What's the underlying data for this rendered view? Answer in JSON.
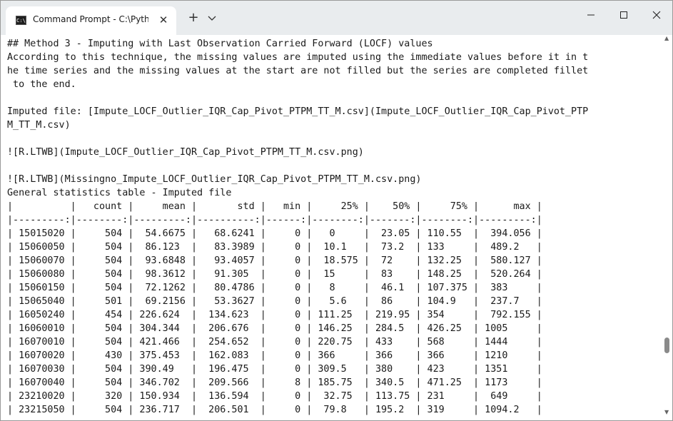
{
  "window": {
    "tab_title": "Command Prompt - C:\\Python",
    "tab_icon_text": "C:\\",
    "tab_close": "✕",
    "new_tab": "+"
  },
  "terminal": {
    "lines": [
      "## Method 3 - Imputing with Last Observation Carried Forward (LOCF) values",
      "According to this technique, the missing values are imputed using the immediate values before it in t",
      "he time series and the missing values at the start are not filled but the series are completed fillet",
      " to the end.",
      "",
      "Imputed file: [Impute_LOCF_Outlier_IQR_Cap_Pivot_PTPM_TT_M.csv](Impute_LOCF_Outlier_IQR_Cap_Pivot_PTP",
      "M_TT_M.csv)",
      "",
      "![R.LTWB](Impute_LOCF_Outlier_IQR_Cap_Pivot_PTPM_TT_M.csv.png)",
      "",
      "![R.LTWB](Missingno_Impute_LOCF_Outlier_IQR_Cap_Pivot_PTPM_TT_M.csv.png)",
      "General statistics table - Imputed file",
      "|          |   count |     mean |       std |   min |     25% |    50% |     75% |      max |",
      "|---------:|--------:|---------:|----------:|------:|--------:|-------:|--------:|---------:|",
      "| 15015020 |     504 |  54.6675 |   68.6241 |     0 |   0     |  23.05 | 110.55  |  394.056 |",
      "| 15060050 |     504 |  86.123  |   83.3989 |     0 |  10.1   |  73.2  | 133     |  489.2   |",
      "| 15060070 |     504 |  93.6848 |   93.4057 |     0 |  18.575 |  72    | 132.25  |  580.127 |",
      "| 15060080 |     504 |  98.3612 |   91.305  |     0 |  15     |  83    | 148.25  |  520.264 |",
      "| 15060150 |     504 |  72.1262 |   80.4786 |     0 |   8     |  46.1  | 107.375 |  383     |",
      "| 15065040 |     501 |  69.2156 |   53.3627 |     0 |   5.6   |  86    | 104.9   |  237.7   |",
      "| 16050240 |     454 | 226.624  |  134.623  |     0 | 111.25  | 219.95 | 354     |  792.155 |",
      "| 16060010 |     504 | 304.344  |  206.676  |     0 | 146.25  | 284.5  | 426.25  | 1005     |",
      "| 16070010 |     504 | 421.466  |  254.652  |     0 | 220.75  | 433    | 568     | 1444     |",
      "| 16070020 |     430 | 375.453  |  162.083  |     0 | 366     | 366    | 366     | 1210     |",
      "| 16070030 |     504 | 390.49   |  196.475  |     0 | 309.5   | 380    | 423     | 1351     |",
      "| 16070040 |     504 | 346.702  |  209.566  |     8 | 185.75  | 340.5  | 471.25  | 1173     |",
      "| 23210020 |     320 | 150.934  |  136.594  |     0 |  32.75  | 113.75 | 231     |  649     |",
      "| 23215050 |     504 | 236.717  |  206.501  |     0 |  79.8   | 195.2  | 319     | 1094.2   |"
    ]
  }
}
